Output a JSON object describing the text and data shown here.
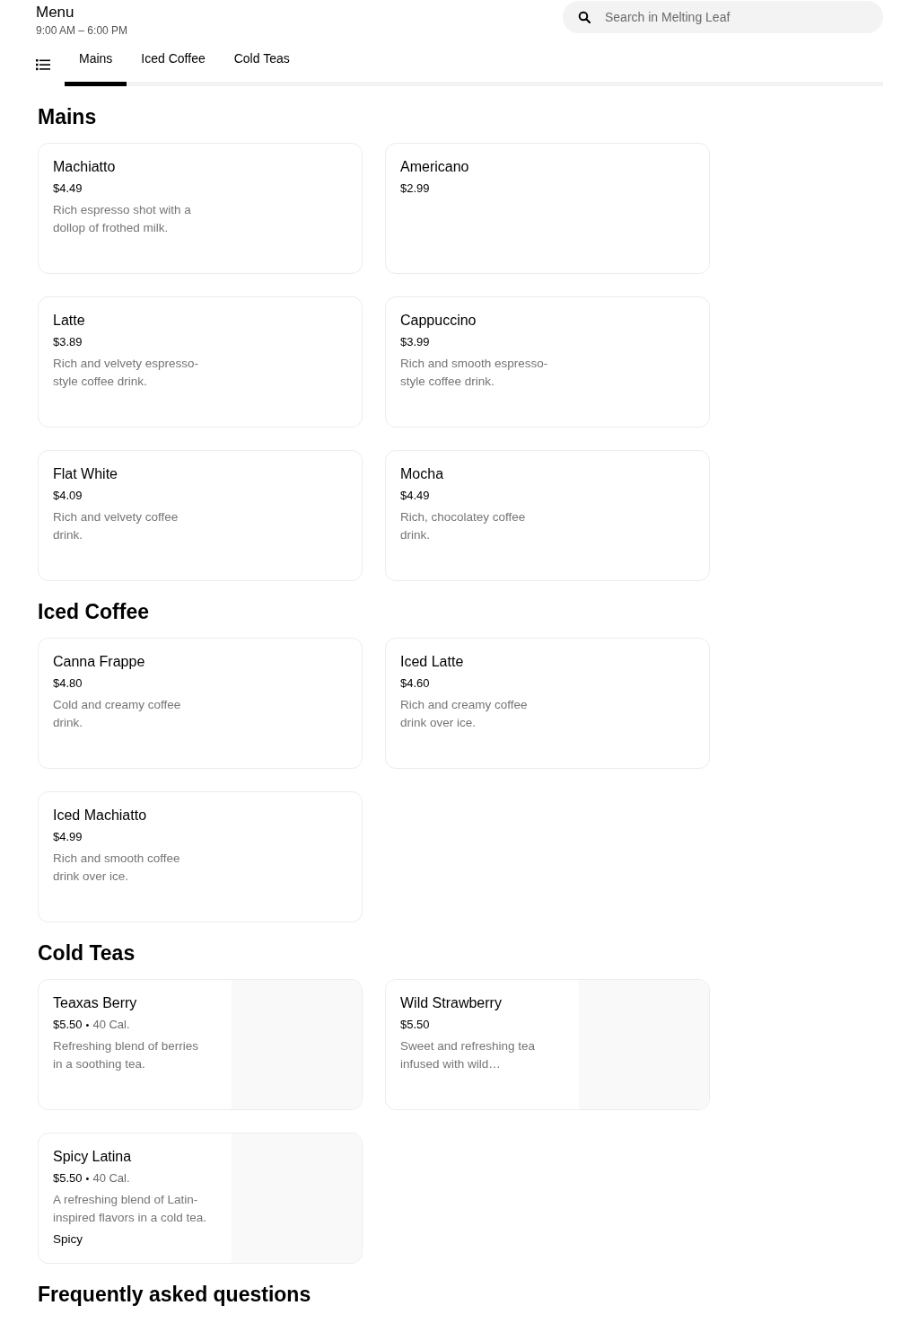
{
  "header": {
    "title": "Menu",
    "hours": "9:00 AM – 6:00 PM",
    "search": {
      "placeholder": "Search in Melting Leaf"
    }
  },
  "tabs": [
    {
      "label": "Mains",
      "selected": true
    },
    {
      "label": "Iced Coffee",
      "selected": false
    },
    {
      "label": "Cold Teas",
      "selected": false
    }
  ],
  "sections": [
    {
      "title": "Mains",
      "items": [
        {
          "name": "Machiatto",
          "price": "$4.49",
          "description": "Rich espresso shot with a dollop of frothed milk."
        },
        {
          "name": "Americano",
          "price": "$2.99"
        },
        {
          "name": "Latte",
          "price": "$3.89",
          "description": "Rich and velvety espresso-style coffee drink."
        },
        {
          "name": "Cappuccino",
          "price": "$3.99",
          "description": "Rich and smooth espresso-style coffee drink."
        },
        {
          "name": "Flat White",
          "price": "$4.09",
          "description": "Rich and velvety coffee drink."
        },
        {
          "name": "Mocha",
          "price": "$4.49",
          "description": "Rich, chocolatey coffee drink."
        }
      ]
    },
    {
      "title": "Iced Coffee",
      "items": [
        {
          "name": "Canna Frappe",
          "price": "$4.80",
          "description": "Cold and creamy coffee drink."
        },
        {
          "name": "Iced Latte",
          "price": "$4.60",
          "description": "Rich and creamy coffee drink over ice."
        },
        {
          "name": "Iced Machiatto",
          "price": "$4.99",
          "description": "Rich and smooth coffee drink over ice."
        }
      ]
    },
    {
      "title": "Cold Teas",
      "items": [
        {
          "name": "Teaxas Berry",
          "price": "$5.50",
          "separator": "•",
          "calories": "40 Cal.",
          "description": "Refreshing blend of berries in a soothing tea.",
          "image_placeholder": true
        },
        {
          "name": "Wild Strawberry",
          "price": "$5.50",
          "description": "Sweet and refreshing tea infused with wild…",
          "image_placeholder": true
        },
        {
          "name": "Spicy Latina",
          "price": "$5.50",
          "separator": "•",
          "calories": "40 Cal.",
          "description": "A refreshing blend of Latin-inspired flavors in a cold tea.",
          "tag": "Spicy",
          "image_placeholder": true
        }
      ]
    }
  ],
  "faq": {
    "title": "Frequently asked questions"
  }
}
